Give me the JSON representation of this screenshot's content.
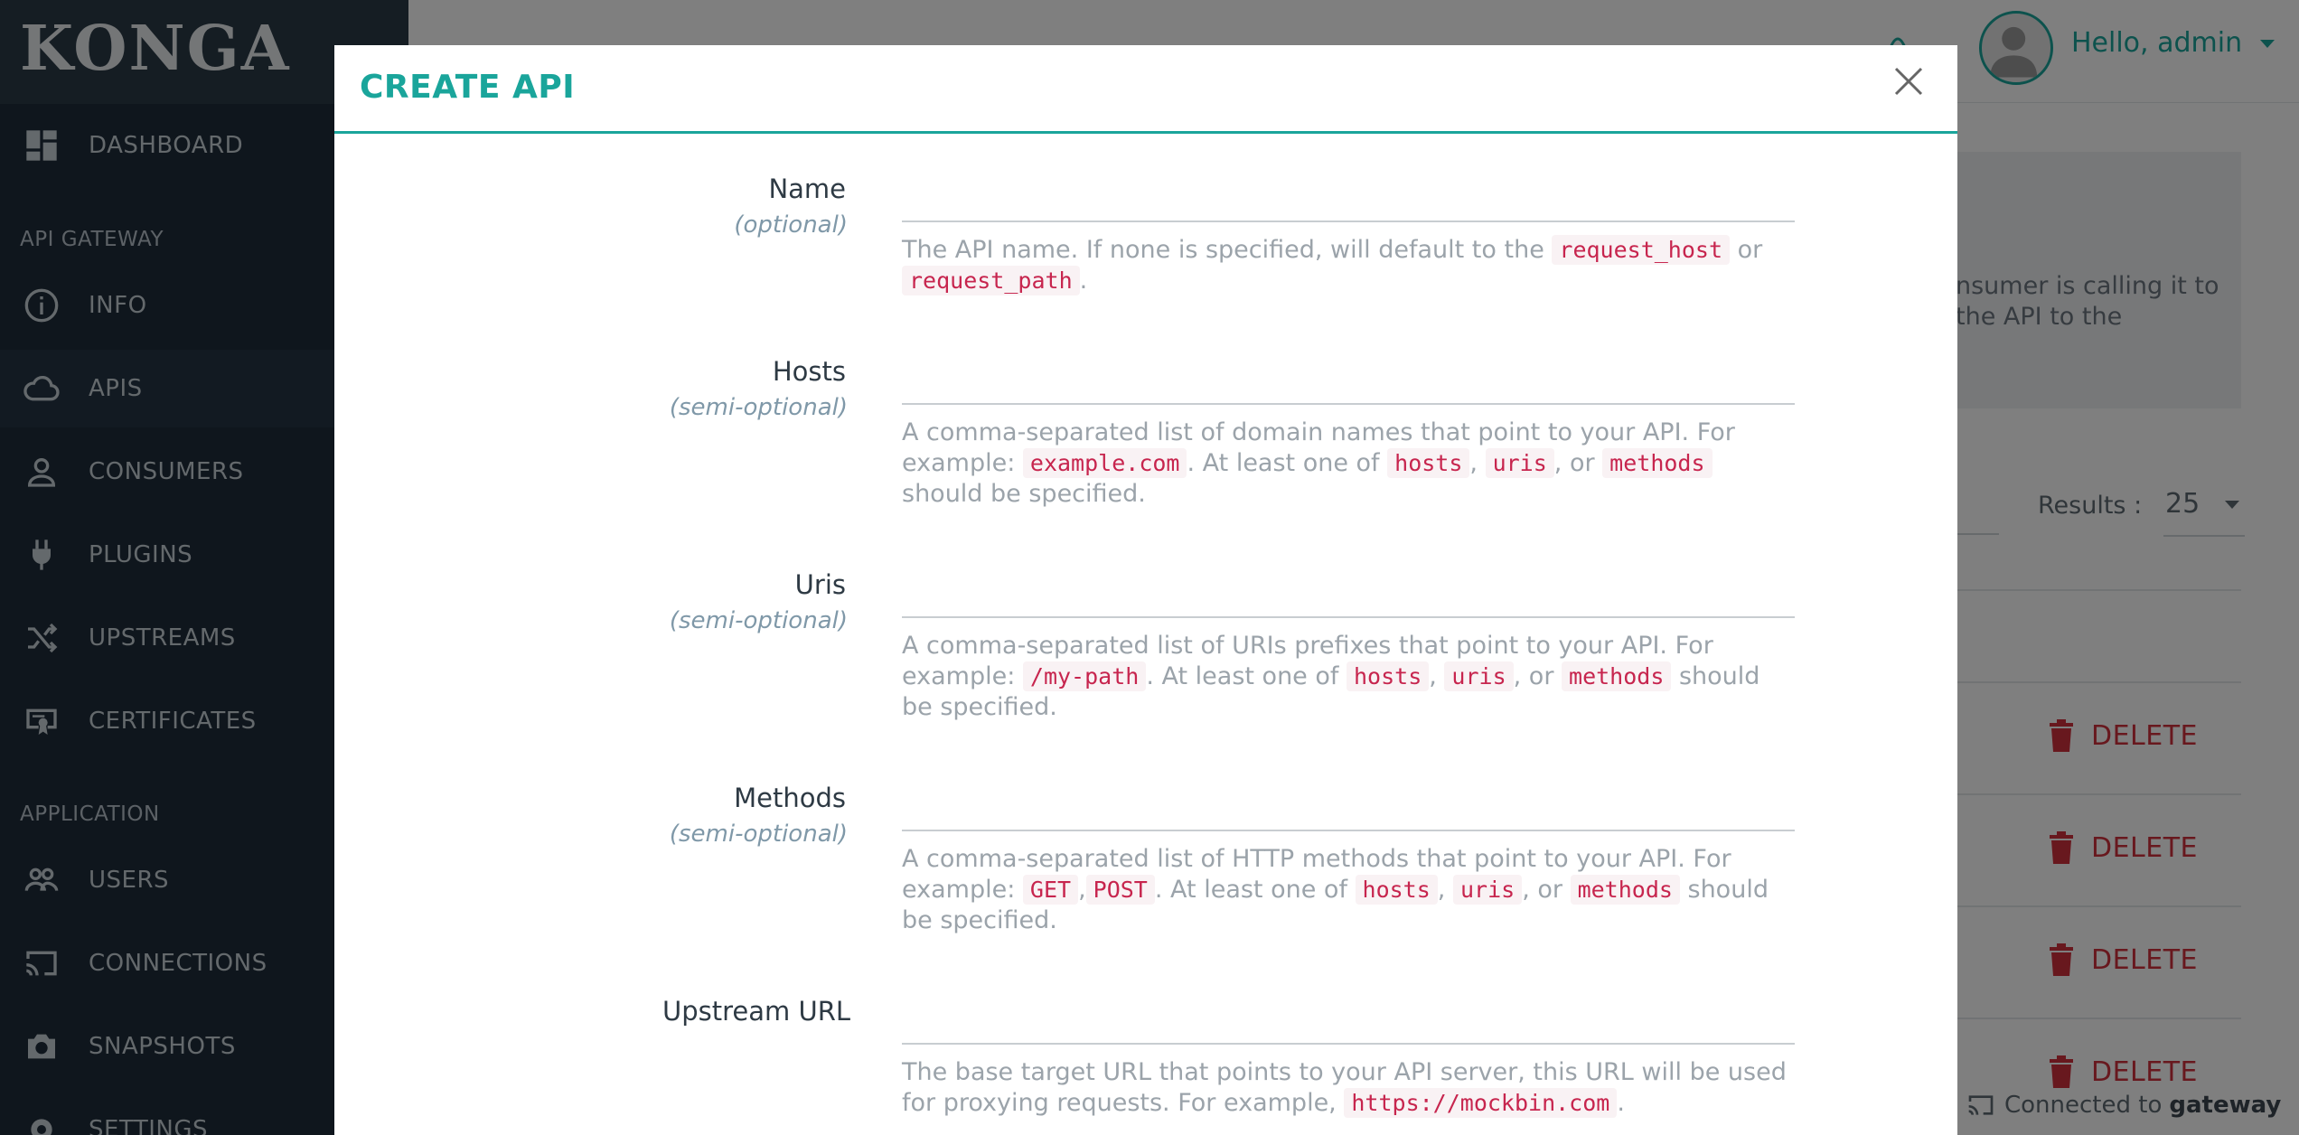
{
  "sidebar": {
    "logo": "KONGA",
    "items": [
      {
        "label": "DASHBOARD",
        "icon": "dashboard-icon"
      },
      {
        "section": "API GATEWAY"
      },
      {
        "label": "INFO",
        "icon": "info-icon"
      },
      {
        "label": "APIS",
        "icon": "cloud-icon",
        "active": true
      },
      {
        "label": "CONSUMERS",
        "icon": "user-icon"
      },
      {
        "label": "PLUGINS",
        "icon": "plug-icon"
      },
      {
        "label": "UPSTREAMS",
        "icon": "shuffle-icon"
      },
      {
        "label": "CERTIFICATES",
        "icon": "certificate-icon"
      },
      {
        "section": "APPLICATION"
      },
      {
        "label": "USERS",
        "icon": "users-icon"
      },
      {
        "label": "CONNECTIONS",
        "icon": "cast-icon"
      },
      {
        "label": "SNAPSHOTS",
        "icon": "camera-icon"
      },
      {
        "label": "SETTINGS",
        "icon": "gear-icon"
      }
    ]
  },
  "header": {
    "greeting": "Hello, admin"
  },
  "background": {
    "info_text": "nsumer is calling it to the API to the",
    "results_label": "Results :",
    "results_value": "25",
    "delete_label": "DELETE",
    "status_prefix": "Connected to",
    "status_gateway": "gateway"
  },
  "modal": {
    "title": "CREATE API",
    "fields": {
      "name": {
        "label": "Name",
        "sub": "(optional)",
        "help_1": "The API name. If none is specified, will default to the ",
        "code_1": "request_host",
        "help_2": " or ",
        "code_2": "request_path",
        "help_3": "."
      },
      "hosts": {
        "label": "Hosts",
        "sub": "(semi-optional)",
        "help_1": "A comma-separated list of domain names that point to your API. For example: ",
        "code_1": "example.com",
        "help_2": ". At least one of ",
        "code_2": "hosts",
        "help_3": ", ",
        "code_3": "uris",
        "help_4": ", or ",
        "code_4": "methods",
        "help_5": " should be specified."
      },
      "uris": {
        "label": "Uris",
        "sub": "(semi-optional)",
        "help_1": "A comma-separated list of URIs prefixes that point to your API. For example: ",
        "code_1": "/my-path",
        "help_2": ". At least one of ",
        "code_2": "hosts",
        "help_3": ", ",
        "code_3": "uris",
        "help_4": ", or ",
        "code_4": "methods",
        "help_5": " should be specified."
      },
      "methods": {
        "label": "Methods",
        "sub": "(semi-optional)",
        "help_1": "A comma-separated list of HTTP methods that point to your API. For example: ",
        "code_1": "GET",
        "help_2": ",",
        "code_2": "POST",
        "help_3": ". At least one of ",
        "code_3": "hosts",
        "help_4": ", ",
        "code_4": "uris",
        "help_5": ", or ",
        "code_5": "methods",
        "help_6": " should be specified."
      },
      "upstream_url": {
        "label": "Upstream URL",
        "help_1": "The base target URL that points to your API server, this URL will be used for proxying requests. For example, ",
        "code_1": "https://mockbin.com",
        "help_2": "."
      }
    }
  },
  "colors": {
    "accent": "#1aa59b",
    "sidebar_bg": "#1f2d3a",
    "delete": "#d0303d",
    "code": "#c7254e"
  }
}
